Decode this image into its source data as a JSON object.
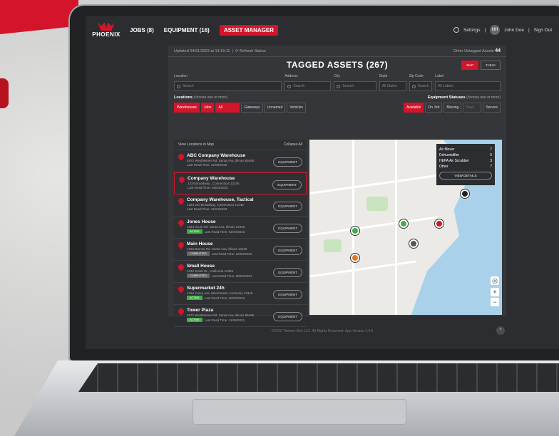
{
  "nav": {
    "logo": "PHOENIX",
    "jobs": "JOBS (8)",
    "equipment": "EQUIPMENT (16)",
    "asset_manager": "ASSET MANAGER",
    "settings": "Settings",
    "avatar_initials": "NH",
    "user_name": "John Doe",
    "sign_out": "Sign Out"
  },
  "meta": {
    "updated": "Updated 04/01/2023 at 13:15:11",
    "refresh": "Refresh Status",
    "untagged_label": "Other Untagged Assets",
    "untagged_count": "44"
  },
  "title": "TAGGED ASSETS (267)",
  "view_toggle": {
    "map": "MAP",
    "table": "TABLE"
  },
  "filters": {
    "location_label": "Location",
    "address_label": "Address",
    "city_label": "City",
    "state_label": "State",
    "zip_label": "Zip Code",
    "label_label": "Label",
    "search": "Search",
    "all_states": "All States",
    "all_labels": "All Labels"
  },
  "locations_heading": "Locations",
  "locations_hint": "(choose one or more)",
  "location_chips": [
    "Warehouses",
    "Jobs",
    "All",
    "Gateways",
    "Unnamed",
    "Vehicles"
  ],
  "statuses_heading": "Equipment Statuses",
  "statuses_hint": "(choose one or more)",
  "status_chips": [
    "Available",
    "On Job",
    "Missing",
    "Days",
    "Service"
  ],
  "list": {
    "view_map": "View Locations in Map",
    "collapse": "Collapse All",
    "equipment_btn": "EQUIPMENT",
    "items": [
      {
        "name": "ABC Company Warehouse",
        "addr": "2972 Westheimer Rd. Santa Ana, Illinois 85486",
        "read": "Last Read Time: 11/08/2022",
        "badge": ""
      },
      {
        "name": "Company Warehouse",
        "addr": "1234 Broadway , Connecticut 12345",
        "read": "Last Read Time: 03/04/2023",
        "badge": ""
      },
      {
        "name": "Company Warehouse, Tactical",
        "addr": "1234 2nd Broadway, Connecticut 12345",
        "read": "Last Read Time: 11/04/2023",
        "badge": ""
      },
      {
        "name": "Jones House",
        "addr": "1234 Gruin Rd. Santa Ana, Illinois 12345",
        "read": "Last Read Time: 01/04/2023",
        "badge": "ACTIVE"
      },
      {
        "name": "Main House",
        "addr": "1234 Barrow Rd. Santa Ana, Illinois 12345",
        "read": "Last Read Time: 15/04/2023",
        "badge": "COMPLETED"
      },
      {
        "name": "Small House",
        "addr": "1234 Small str., California 12345",
        "read": "Last Read Time: 08/04/2024",
        "badge": "COMPLETED"
      },
      {
        "name": "Supermarket 24h",
        "addr": "1234 Curvy Ave, Manchester, Kentucky 12345",
        "read": "Last Read Time: 02/02/2023",
        "badge": "ACTIVE"
      },
      {
        "name": "Tower Plaza",
        "addr": "2972 Westheimer Rd. Santa Ana, Illinois 85486",
        "read": "Last Read Time: 11/08/2022",
        "badge": "ACTIVE"
      }
    ]
  },
  "popup": {
    "rows": [
      [
        "Air Mover",
        "7"
      ],
      [
        "Dehumidifier",
        "5"
      ],
      [
        "HEPA Air Scrubber",
        "3"
      ],
      [
        "Other",
        "7"
      ]
    ],
    "button": "VIEW DETAILS"
  },
  "footer": "©2022 Thermo-Dox LLC. All Rights Reserved. App Version 1.9.5"
}
